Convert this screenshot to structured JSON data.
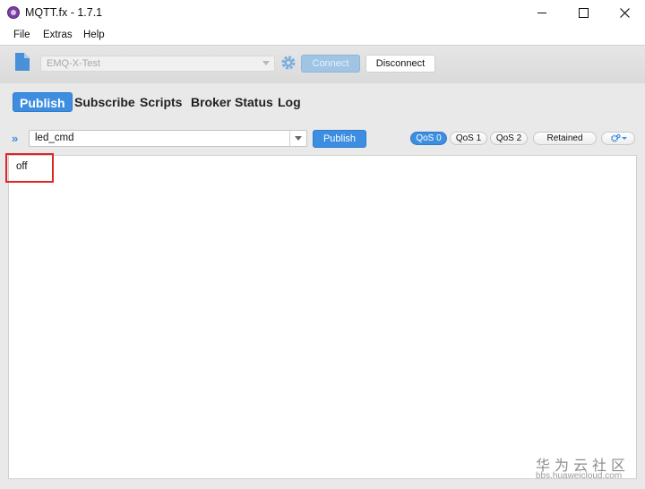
{
  "window": {
    "title": "MQTT.fx - 1.7.1"
  },
  "menu": [
    "File",
    "Extras",
    "Help"
  ],
  "connection": {
    "profile": "EMQ-X-Test",
    "connect_label": "Connect",
    "disconnect_label": "Disconnect"
  },
  "tabs": [
    "Publish",
    "Subscribe",
    "Scripts",
    "Broker Status",
    "Log"
  ],
  "active_tab": "Publish",
  "publish": {
    "topic": "led_cmd",
    "publish_label": "Publish",
    "qos": [
      "QoS 0",
      "QoS 1",
      "QoS 2"
    ],
    "selected_qos": "QoS 0",
    "retained_label": "Retained",
    "payload": "off"
  },
  "watermark": {
    "main": "华为云社区",
    "sub": "bbs.huaweicloud.com"
  },
  "colors": {
    "accent": "#3d8ee0",
    "highlight": "#e02424"
  }
}
